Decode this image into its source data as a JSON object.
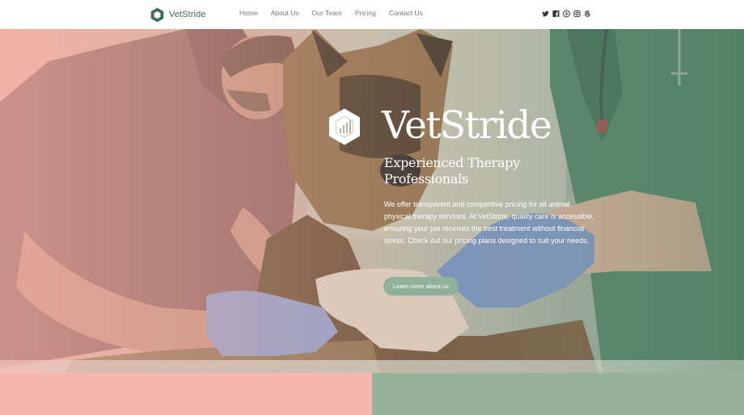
{
  "brand": {
    "name": "VetStride"
  },
  "nav": {
    "items": [
      {
        "label": "Home"
      },
      {
        "label": "About Us"
      },
      {
        "label": "Our Team"
      },
      {
        "label": "Pricing"
      },
      {
        "label": "Contact Us"
      }
    ]
  },
  "social": [
    "twitter-icon",
    "facebook-icon",
    "pinterest-icon",
    "instagram-icon",
    "threads-icon"
  ],
  "hero": {
    "title": "VetStride",
    "subtitle": "Experienced Therapy Professionals",
    "description": "We offer transparent and competitive pricing for all animal physical therapy services. At VetStride, quality care is accessible, ensuring your pet receives the best treatment without financial stress. Check out our pricing plans designed to suit your needs.",
    "button_label": "Learn more about us"
  },
  "colors": {
    "brand_green": "#3f6f54",
    "button_green": "#8fb09b",
    "strip_pink": "#f5b6ae",
    "strip_green": "#97b29b",
    "nav_text": "#777777"
  }
}
